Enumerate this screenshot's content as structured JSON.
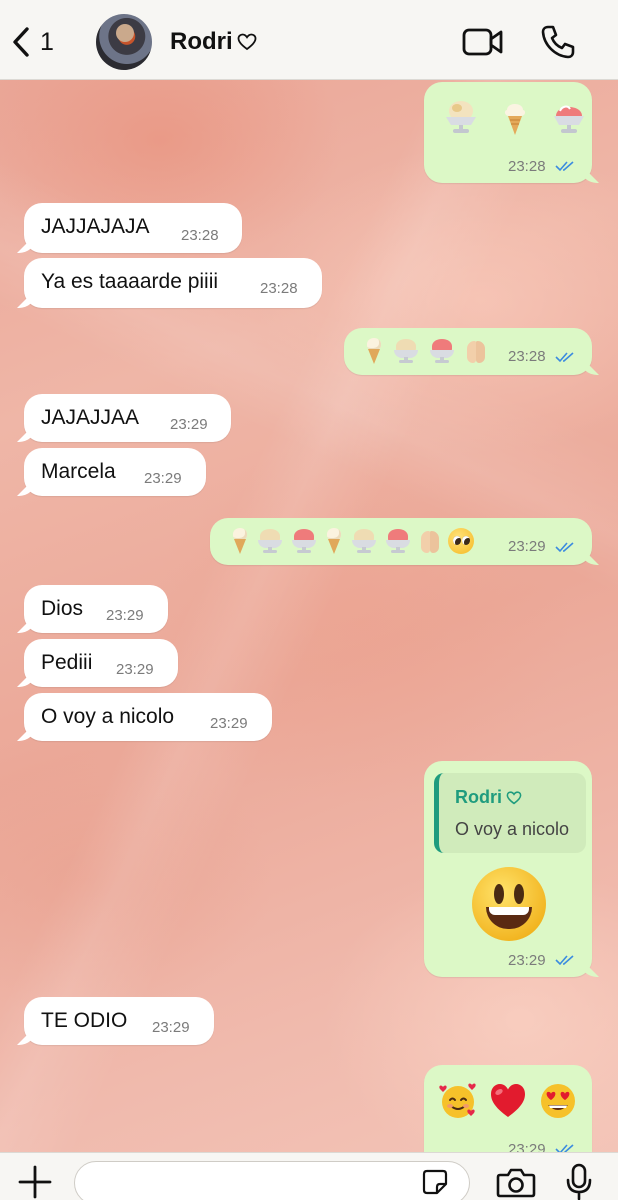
{
  "header": {
    "back_icon": "chevron-left-icon",
    "unread_count": "1",
    "contact_name": "Rodri",
    "contact_name_icon": "heart-outline-icon",
    "video_icon": "video-camera-icon",
    "call_icon": "phone-icon"
  },
  "messages": [
    {
      "direction": "out",
      "emojis": [
        "sundae",
        "ice-cream",
        "shaved-ice"
      ],
      "time": "23:28",
      "status": "read"
    },
    {
      "direction": "in",
      "text": "JAJJAJAJA",
      "time": "23:28"
    },
    {
      "direction": "in",
      "text": "Ya es taaaarde piiii",
      "time": "23:28"
    },
    {
      "direction": "out",
      "emojis": [
        "ice-cream",
        "sundae",
        "shaved-ice",
        "folded-hands"
      ],
      "time": "23:28",
      "status": "read"
    },
    {
      "direction": "in",
      "text": "JAJAJJAA",
      "time": "23:29"
    },
    {
      "direction": "in",
      "text": "Marcela",
      "time": "23:29"
    },
    {
      "direction": "out",
      "emojis": [
        "ice-cream",
        "sundae",
        "shaved-ice",
        "ice-cream",
        "sundae",
        "shaved-ice",
        "folded-hands",
        "pleading-face"
      ],
      "time": "23:29",
      "status": "read"
    },
    {
      "direction": "in",
      "text": "Dios",
      "time": "23:29"
    },
    {
      "direction": "in",
      "text": "Pediii",
      "time": "23:29"
    },
    {
      "direction": "in",
      "text": "O voy a nicolo",
      "time": "23:29"
    },
    {
      "direction": "out",
      "reply_to": {
        "name": "Rodri",
        "text": "O voy a nicolo"
      },
      "emojis": [
        "grinning-face"
      ],
      "time": "23:29",
      "status": "read"
    },
    {
      "direction": "in",
      "text": "TE ODIO",
      "time": "23:29"
    },
    {
      "direction": "out",
      "emojis": [
        "smiling-face-with-hearts",
        "red-heart",
        "heart-eyes"
      ],
      "time": "23:29",
      "status": "read"
    }
  ],
  "composer": {
    "add_icon": "plus-icon",
    "placeholder": "",
    "sticker_icon": "sticker-icon",
    "camera_icon": "camera-icon",
    "mic_icon": "microphone-icon"
  },
  "colors": {
    "incoming_bubble": "#ffffff",
    "outgoing_bubble": "#dcf8c6",
    "read_ticks": "#3b8be0",
    "reply_accent": "#1f9c7e"
  }
}
